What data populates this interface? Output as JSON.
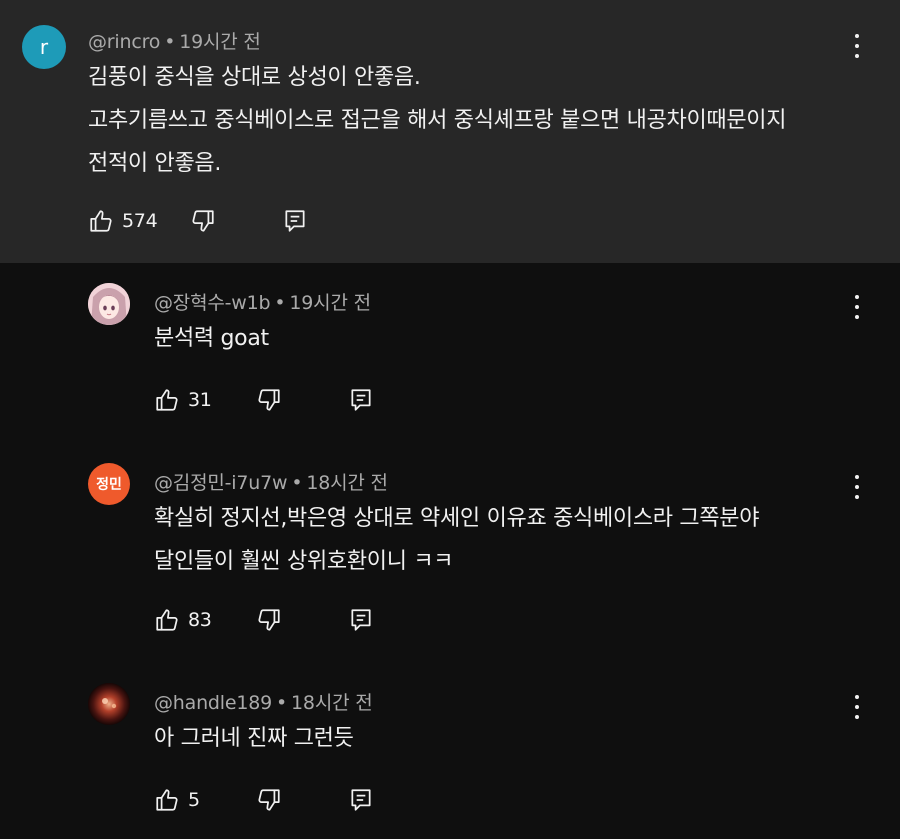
{
  "comments": [
    {
      "author": "@rincro",
      "time": "19시간 전",
      "avatar_letter": "r",
      "avatar_color": "#1e9bb8",
      "lines": [
        "김풍이 중식을 상대로 상성이 안좋음.",
        "고추기름쓰고 중식베이스로 접근을 해서 중식셰프랑 붙으면 내공차이때문이지",
        "전적이 안좋음."
      ],
      "likes": "574"
    }
  ],
  "replies": [
    {
      "author": "@장혁수-w1b",
      "time": "19시간 전",
      "avatar_type": "anime-portrait",
      "lines": [
        "분석력 goat"
      ],
      "likes": "31"
    },
    {
      "author": "@김정민-i7u7w",
      "time": "18시간 전",
      "avatar_text": "정민",
      "avatar_color": "#ef5a2c",
      "lines": [
        "확실히 정지선,박은영 상대로 약세인 이유죠 중식베이스라 그쪽분야",
        "달인들이 훨씬 상위호환이니 ㅋㅋ"
      ],
      "likes": "83"
    },
    {
      "author": "@handle189",
      "time": "18시간 전",
      "avatar_type": "dark-photo",
      "lines": [
        "아 그러네 진짜 그런듯"
      ],
      "likes": "5"
    }
  ],
  "separator": "•",
  "icons": {
    "like": "thumb-up-icon",
    "dislike": "thumb-down-icon",
    "reply": "reply-icon",
    "menu": "more-vertical-icon"
  },
  "colors": {
    "page_bg": "#0f0f0f",
    "highlight_bg": "#272727",
    "meta_text": "#aaaaaa",
    "body_text": "#f1f1f1"
  }
}
